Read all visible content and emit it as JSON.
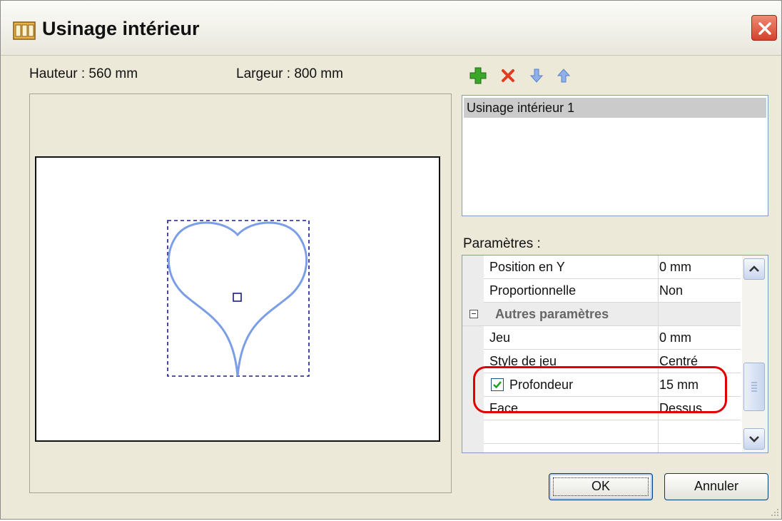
{
  "window": {
    "title": "Usinage intérieur"
  },
  "dimensions": {
    "height_label": "Hauteur : 560 mm",
    "width_label": "Largeur : 800 mm"
  },
  "toolbar": {
    "icons": [
      "add-icon",
      "delete-icon",
      "move-down-icon",
      "move-up-icon"
    ]
  },
  "machining_list": {
    "items": [
      "Usinage intérieur 1"
    ],
    "selected_index": 0
  },
  "params": {
    "label": "Paramètres :",
    "rows": [
      {
        "name": "Position en Y",
        "value": "0 mm"
      },
      {
        "name": "Proportionnelle",
        "value": "Non"
      }
    ],
    "category": "Autres paramètres",
    "rows2": [
      {
        "name": "Jeu",
        "value": "0 mm"
      },
      {
        "name": "Style de jeu",
        "value": "Centré"
      },
      {
        "name": "Profondeur",
        "value": "15 mm",
        "checked": true
      },
      {
        "name": "Face",
        "value": "Dessus"
      }
    ]
  },
  "buttons": {
    "ok": "OK",
    "cancel": "Annuler"
  },
  "colors": {
    "shape": "#7b9ee6",
    "highlight": "#e00000",
    "selection": "#cbcbcb"
  }
}
